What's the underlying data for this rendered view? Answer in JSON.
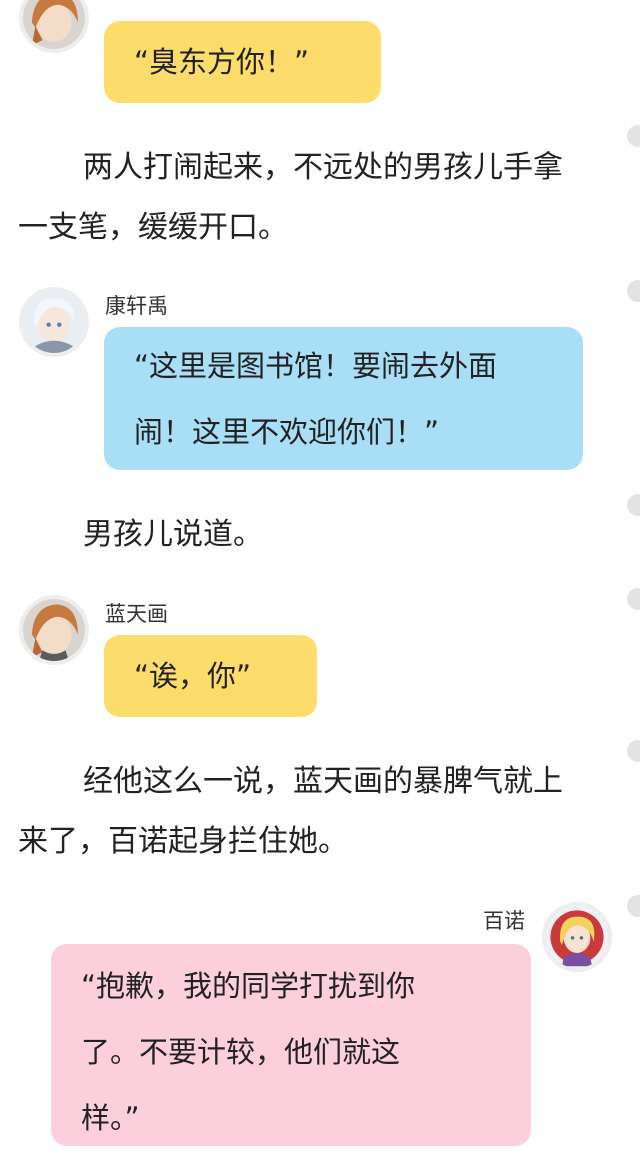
{
  "messages": {
    "m1": {
      "text": "“臭东方你！”"
    },
    "m2": {
      "speaker": "康轩禹",
      "line1": "“这里是图书馆！要闹去外面",
      "line2": "闹！这里不欢迎你们！”"
    },
    "m3": {
      "speaker": "蓝天画",
      "text": "“诶，你”"
    },
    "m4": {
      "speaker": "百诺",
      "line1": "“抱歉，我的同学打扰到你",
      "line2": "了。不要计较，他们就这",
      "line3": "样。”"
    }
  },
  "narration": {
    "n1": {
      "line1": "两人打闹起来，不远处的男孩儿手拿",
      "line2": "一支笔，缓缓开口。"
    },
    "n2": {
      "line1": "男孩儿说道。"
    },
    "n3": {
      "line1": "经他这么一说，蓝天画的暴脾气就上",
      "line2": "来了，百诺起身拦住她。"
    }
  },
  "colors": {
    "yellow_bubble": "#fcdc6a",
    "blue_bubble": "#a9def7",
    "pink_bubble": "#fbcfdc"
  },
  "icons": [
    "avatar-orange-hair",
    "avatar-white-hair",
    "avatar-blonde-hair"
  ]
}
